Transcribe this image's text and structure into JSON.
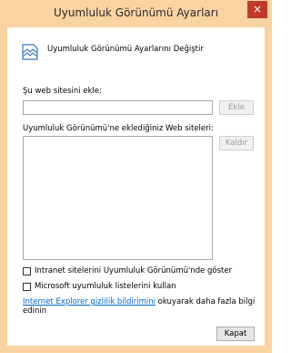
{
  "window": {
    "title": "Uyumluluk Görünümü Ayarları",
    "close_glyph": "×"
  },
  "header": {
    "icon": "compatibility-view-icon",
    "text": "Uyumluluk Görünümü Ayarlarını Değiştir"
  },
  "add_section": {
    "label": "Şu web sitesini ekle:",
    "input_value": "",
    "add_button": "Ekle"
  },
  "list_section": {
    "label": "Uyumluluk Görünümü'ne eklediğiniz Web siteleri:",
    "items": [],
    "remove_button": "Kaldır"
  },
  "options": {
    "intranet_label": "Intranet sitelerini Uyumluluk Görünümü'nde göster",
    "intranet_checked": false,
    "ms_lists_label": "Microsoft uyumluluk listelerini kullan",
    "ms_lists_checked": false
  },
  "privacy": {
    "link_text": "Internet Explorer gizlilik bildirimini",
    "suffix_text": " okuyarak daha fazla bilgi edinin"
  },
  "footer": {
    "close_button": "Kapat"
  },
  "colors": {
    "frame": "#f9d3a1",
    "close_red": "#c0392b",
    "link": "#0066cc"
  }
}
